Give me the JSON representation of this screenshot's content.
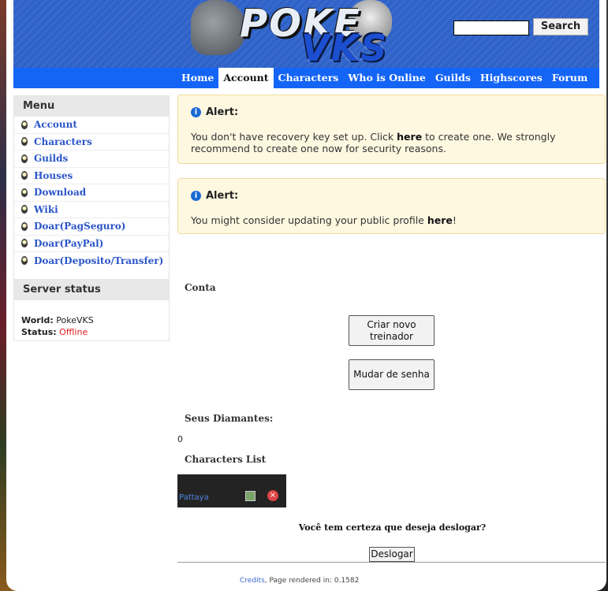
{
  "header": {
    "logo_text_top": "POKE",
    "logo_text_bottom": "VKS",
    "search_placeholder": "",
    "search_button": "Search"
  },
  "nav": {
    "items": [
      {
        "label": "Home",
        "active": false
      },
      {
        "label": "Account",
        "active": true
      },
      {
        "label": "Characters",
        "active": false
      },
      {
        "label": "Who is Online",
        "active": false
      },
      {
        "label": "Guilds",
        "active": false
      },
      {
        "label": "Highscores",
        "active": false
      },
      {
        "label": "Forum",
        "active": false
      }
    ]
  },
  "sidebar": {
    "menu_title": "Menu",
    "items": [
      {
        "label": "Account"
      },
      {
        "label": "Characters"
      },
      {
        "label": "Guilds"
      },
      {
        "label": "Houses"
      },
      {
        "label": "Download"
      },
      {
        "label": "Wiki"
      },
      {
        "label": "Doar(PagSeguro)"
      },
      {
        "label": "Doar(PayPal)"
      },
      {
        "label": "Doar(Deposito/Transfer)"
      }
    ],
    "server_title": "Server status",
    "world_label": "World:",
    "world_value": "PokeVKS",
    "status_label": "Status:",
    "status_value": "Offline",
    "status_color": "#e02020"
  },
  "alerts": [
    {
      "title": "Alert:",
      "text_before": "You don't have recovery key set up. Click ",
      "link": "here",
      "text_after": " to create one. We strongly recommend to create one now for security reasons."
    },
    {
      "title": "Alert:",
      "text_before": "You might consider updating your public profile ",
      "link": "here",
      "text_after": "!"
    }
  ],
  "main": {
    "conta_label": "Conta",
    "btn_new_trainer": "Criar novo treinador",
    "btn_change_password": "Mudar de senha",
    "diamonds_label": "Seus Diamantes:",
    "diamonds_value": "0",
    "characters_list_label": "Characters List",
    "characters": [
      {
        "name": "Pattaya"
      }
    ],
    "logout_confirm": "Você tem certeza que deseja deslogar?",
    "logout_button": "Deslogar"
  },
  "footer": {
    "credits": "Credits",
    "rendered": ", Page rendered in: 0.1582"
  },
  "colors": {
    "header_blue": "#2e62c8",
    "nav_blue": "#1464f6",
    "link_blue": "#2a55c8",
    "alert_bg": "#fff8e1"
  }
}
